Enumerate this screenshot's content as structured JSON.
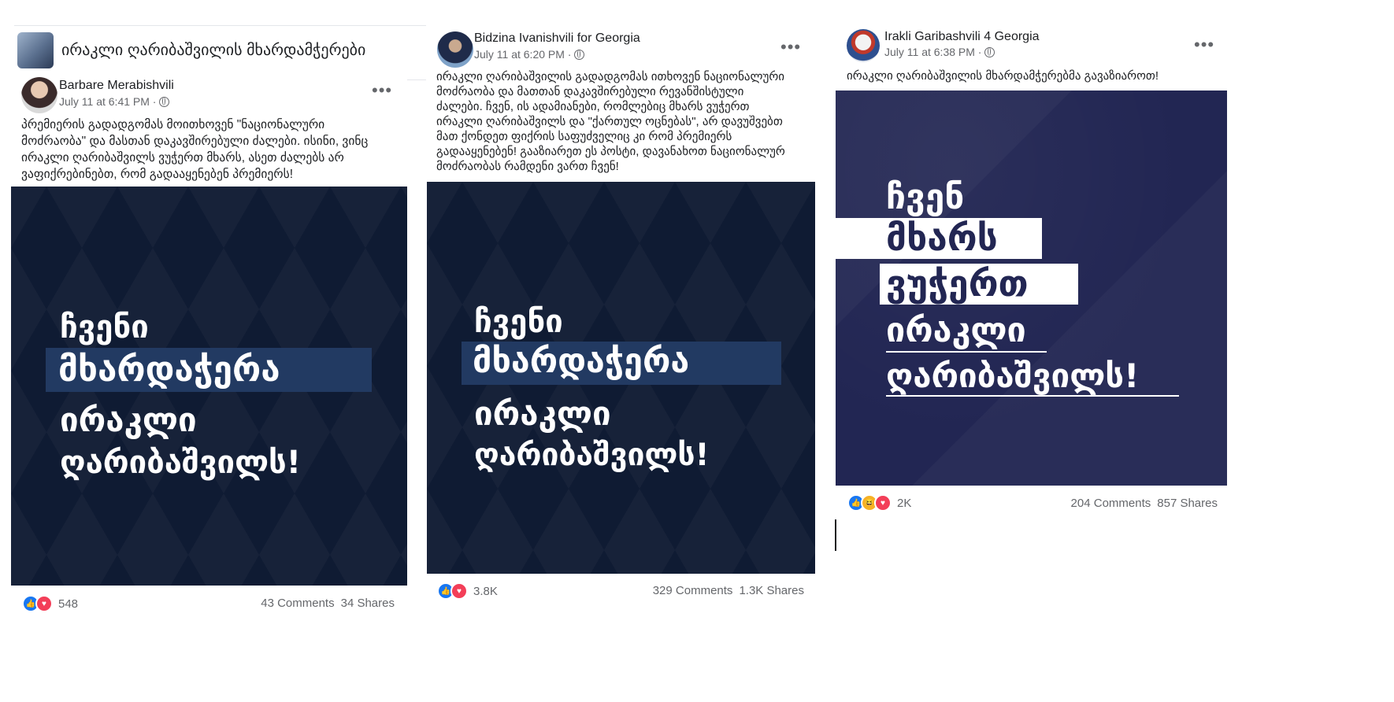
{
  "group": {
    "name": "ირაკლი ღარიბაშვილის მხარდამჭერები"
  },
  "posts": [
    {
      "author": "Barbare Merabishvili",
      "time": "July 11 at 6:41 PM · ",
      "caption": "პრემიერის გადადგომას მოითხოვენ \"ნაციონალური\nმოძრაობა\" და მასთან დაკავშირებული ძალები. ისინი, ვინც\nირაკლი ღარიბაშვილს ვუჭერთ მხარს, ასეთ ძალებს არ\nვაფიქრებინებთ, რომ გადააყენებენ პრემიერს!",
      "image_lines": [
        "ჩვენი",
        "მხარდაჭერა",
        "ირაკლი",
        "ღარიბაშვილს!"
      ],
      "reaction_count": "548",
      "comments": "43 Comments",
      "shares": "34 Shares"
    },
    {
      "author": "Bidzina Ivanishvili for Georgia",
      "time": "July 11 at 6:20 PM · ",
      "caption": "ირაკლი ღარიბაშვილის გადადგომას ითხოვენ ნაციონალური\nმოძრაობა და მათთან დაკავშირებული რევანშისტული\nძალები. ჩვენ, ის ადამიანები, რომლებიც მხარს ვუჭერთ\nირაკლი ღარიბაშვილს და \"ქართულ ოცნებას\", არ დავუშვებთ\nმათ ქონდეთ ფიქრის საფუძველიც კი რომ პრემიერს\nგადააყენებენ! გააზიარეთ ეს პოსტი, დავანახოთ ნაციონალურ\nმოძრაობას რამდენი ვართ ჩვენ!",
      "image_lines": [
        "ჩვენი",
        "მხარდაჭერა",
        "ირაკლი",
        "ღარიბაშვილს!"
      ],
      "reaction_count": "3.8K",
      "comments": "329 Comments",
      "shares": "1.3K Shares"
    },
    {
      "author": "Irakli Garibashvili 4 Georgia",
      "time": "July 11 at 6:38 PM · ",
      "caption": "ირაკლი ღარიბაშვილის მხარდამჭერებმა გავაზიაროთ!",
      "image_lines": [
        "ჩვენ",
        "მხარს",
        "ვუჭერთ",
        "ირაკლი",
        "ღარიბაშვილს!"
      ],
      "reaction_count": "2K",
      "comments": "204 Comments",
      "shares": "857 Shares"
    }
  ],
  "icons": {
    "more": "more-horizontal-icon",
    "privacy": "globe-icon",
    "like": "like-icon",
    "love": "love-icon",
    "haha": "haha-icon"
  },
  "colors": {
    "image_bg_1": "#0f1b33",
    "image_bg_3": "#222653",
    "highlight": "#223a62",
    "like": "#1877f2",
    "love": "#f33e58"
  }
}
